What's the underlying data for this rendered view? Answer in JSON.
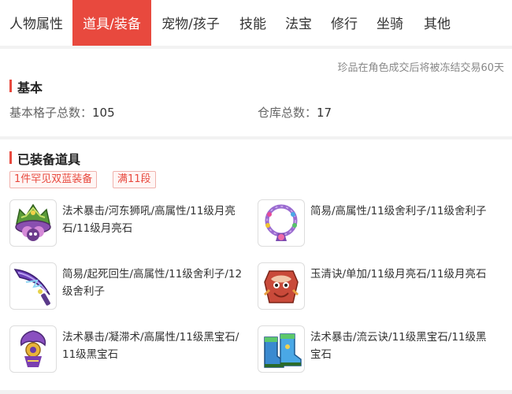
{
  "tabs": [
    {
      "label": "人物属性"
    },
    {
      "label": "道具/装备"
    },
    {
      "label": "宠物/孩子"
    },
    {
      "label": "技能"
    },
    {
      "label": "法宝"
    },
    {
      "label": "修行"
    },
    {
      "label": "坐骑"
    },
    {
      "label": "其他"
    }
  ],
  "basic": {
    "notice": "珍品在角色成交后将被冻结交易60天",
    "title": "基本",
    "slots_label": "基本格子总数：",
    "slots_value": "105",
    "warehouse_label": "仓库总数：",
    "warehouse_value": "17"
  },
  "equipped": {
    "title": "已装备道具",
    "tags": [
      "1件罕见双蓝装备",
      "满11段"
    ],
    "items": [
      {
        "desc": "法术暴击/河东狮吼/高属性/11级月亮石/11级月亮石",
        "icon": "helmet-icon"
      },
      {
        "desc": "简易/高属性/11级舍利子/11级舍利子",
        "icon": "necklace-icon"
      },
      {
        "desc": "简易/起死回生/高属性/11级舍利子/12级舍利子",
        "icon": "weapon-icon"
      },
      {
        "desc": "玉清诀/单加/11级月亮石/11级月亮石",
        "icon": "armor-icon"
      },
      {
        "desc": "法术暴击/凝滞术/高属性/11级黑宝石/11级黑宝石",
        "icon": "belt-icon"
      },
      {
        "desc": "法术暴击/流云诀/11级黑宝石/11级黑宝石",
        "icon": "boots-icon"
      }
    ]
  }
}
